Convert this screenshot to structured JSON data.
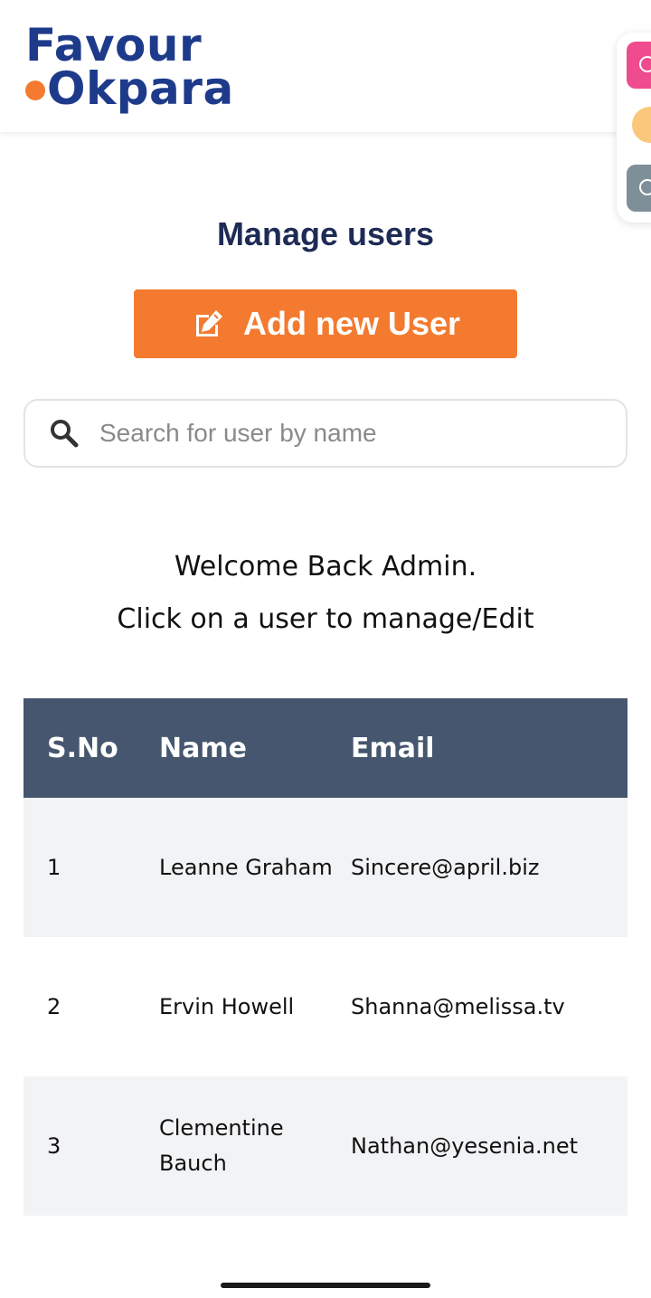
{
  "header": {
    "logo_line1": "Favour",
    "logo_line2": "Okpara"
  },
  "main": {
    "title": "Manage users",
    "add_button_label": "Add new User",
    "search_placeholder": "Search for user by name",
    "welcome_line1": "Welcome Back Admin.",
    "welcome_line2": "Click on a user to manage/Edit"
  },
  "table": {
    "headers": {
      "sno": "S.No",
      "name": "Name",
      "email": "Email"
    },
    "rows": [
      {
        "sno": "1",
        "name": "Leanne Graham",
        "email": "Sincere@april.biz"
      },
      {
        "sno": "2",
        "name": "Ervin Howell",
        "email": "Shanna@melissa.tv"
      },
      {
        "sno": "3",
        "name": "Clementine Bauch",
        "email": "Nathan@yesenia.net"
      }
    ]
  },
  "colors": {
    "brand_blue": "#1e3a8a",
    "accent_orange": "#f47a30",
    "table_header": "#45566e",
    "row_shade": "#f2f3f5"
  },
  "icons": {
    "add_button": "edit-icon",
    "search": "search-icon"
  }
}
